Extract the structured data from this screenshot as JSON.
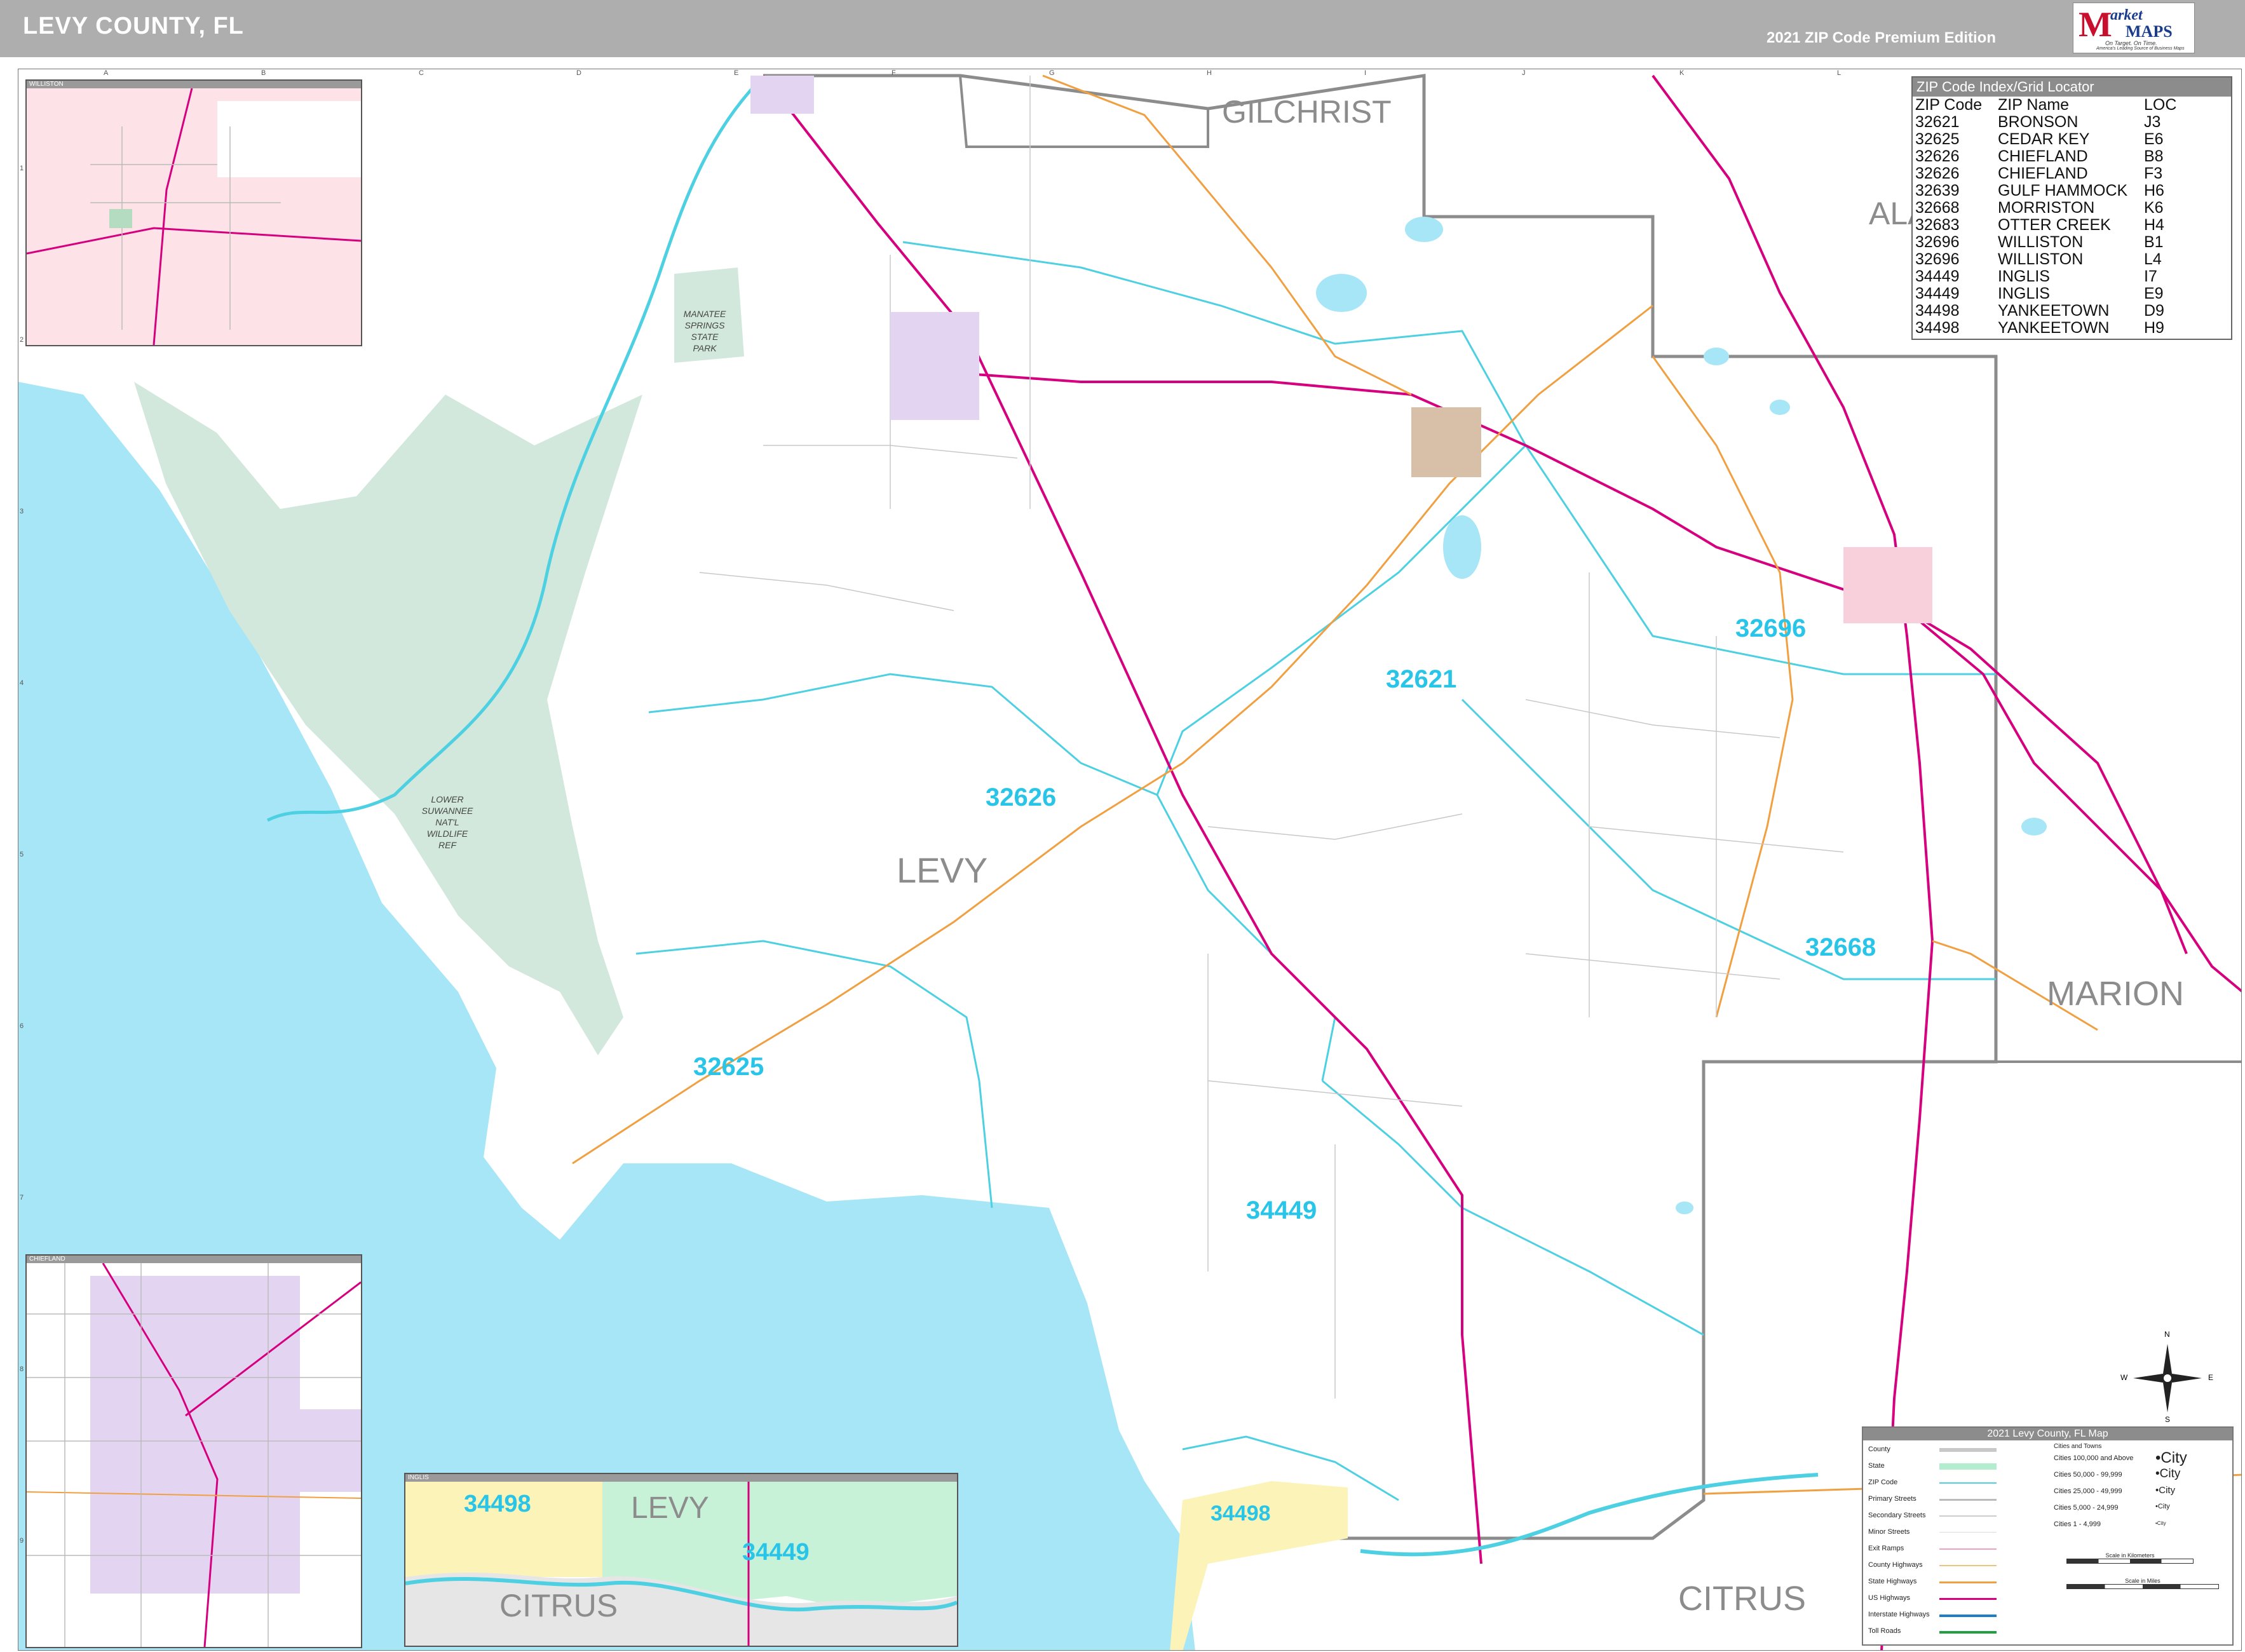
{
  "header": {
    "title": "LEVY COUNTY, FL",
    "edition": "2021 ZIP Code Premium Edition",
    "logo": {
      "mark": "M",
      "word1": "arket",
      "word2": "MAPS",
      "slogan1": "On Target. On Time.",
      "slogan2": "America's Leading Source of Business Maps"
    }
  },
  "map": {
    "counties": {
      "gilchrist": "GILCHRIST",
      "alachua": "ALA",
      "marion": "MARION",
      "citrus": "CITRUS",
      "levy": "LEVY"
    },
    "zip_labels": {
      "z32621": "32621",
      "z32626": "32626",
      "z32696": "32696",
      "z32668": "32668",
      "z32625": "32625",
      "z34449": "34449",
      "z34498": "34498"
    },
    "parks": {
      "manatee": [
        "MANATEE",
        "SPRINGS",
        "STATE",
        "PARK"
      ],
      "suwannee": [
        "LOWER",
        "SUWANNEE",
        "NAT'L",
        "WILDLIFE",
        "REF"
      ]
    },
    "grid_cols": [
      "A",
      "B",
      "C",
      "D",
      "E",
      "F",
      "G",
      "H",
      "I",
      "J",
      "K",
      "L"
    ],
    "grid_rows": [
      "1",
      "2",
      "3",
      "4",
      "5",
      "6",
      "7",
      "8",
      "9"
    ],
    "compass": {
      "n": "N",
      "s": "S",
      "e": "E",
      "w": "W"
    }
  },
  "zip_index": {
    "title": "ZIP Code Index/Grid Locator",
    "columns": [
      "ZIP Code",
      "ZIP Name",
      "LOC"
    ],
    "rows": [
      [
        "32621",
        "BRONSON",
        "J3"
      ],
      [
        "32625",
        "CEDAR KEY",
        "E6"
      ],
      [
        "32626",
        "CHIEFLAND",
        "B8"
      ],
      [
        "32626",
        "CHIEFLAND",
        "F3"
      ],
      [
        "32639",
        "GULF HAMMOCK",
        "H6"
      ],
      [
        "32668",
        "MORRISTON",
        "K6"
      ],
      [
        "32683",
        "OTTER CREEK",
        "H4"
      ],
      [
        "32696",
        "WILLISTON",
        "B1"
      ],
      [
        "32696",
        "WILLISTON",
        "L4"
      ],
      [
        "34449",
        "INGLIS",
        "I7"
      ],
      [
        "34449",
        "INGLIS",
        "E9"
      ],
      [
        "34498",
        "YANKEETOWN",
        "D9"
      ],
      [
        "34498",
        "YANKEETOWN",
        "H9"
      ]
    ]
  },
  "legend": {
    "title": "2021 Levy County, FL Map",
    "items": [
      "County",
      "State",
      "ZIP Code",
      "Primary Streets",
      "Secondary Streets",
      "Minor Streets",
      "Exit Ramps",
      "County Highways",
      "State Highways",
      "US Highways",
      "Interstate Highways",
      "Toll Roads"
    ],
    "cities_title": "Cities and Towns",
    "cities": [
      {
        "range": "Cities 100,000 and Above",
        "sample": "•City"
      },
      {
        "range": "Cities 50,000 - 99,999",
        "sample": "•City"
      },
      {
        "range": "Cities 25,000 - 49,999",
        "sample": "•City"
      },
      {
        "range": "Cities 5,000 - 24,999",
        "sample": "•City"
      },
      {
        "range": "Cities 1 - 4,999",
        "sample": "•City"
      }
    ],
    "scale_km": "Scale in Kilometers",
    "scale_mi": "Scale in Miles"
  },
  "insets": {
    "williston": "WILLISTON",
    "chiefland": "CHIEFLAND",
    "inglis": "INGLIS",
    "inglis_labels": {
      "z34498": "34498",
      "z34449": "34449",
      "levy": "LEVY",
      "citrus": "CITRUS"
    }
  },
  "colors": {
    "water": "#a6e6f7",
    "park": "#d2e8dc",
    "zip_line": "#4dd0e1",
    "zip_label": "#29c5e8",
    "us_highway": "#d6007e",
    "state_highway": "#f0a040",
    "county_label": "#8c8c8c",
    "title_bar": "#aeaeae"
  }
}
